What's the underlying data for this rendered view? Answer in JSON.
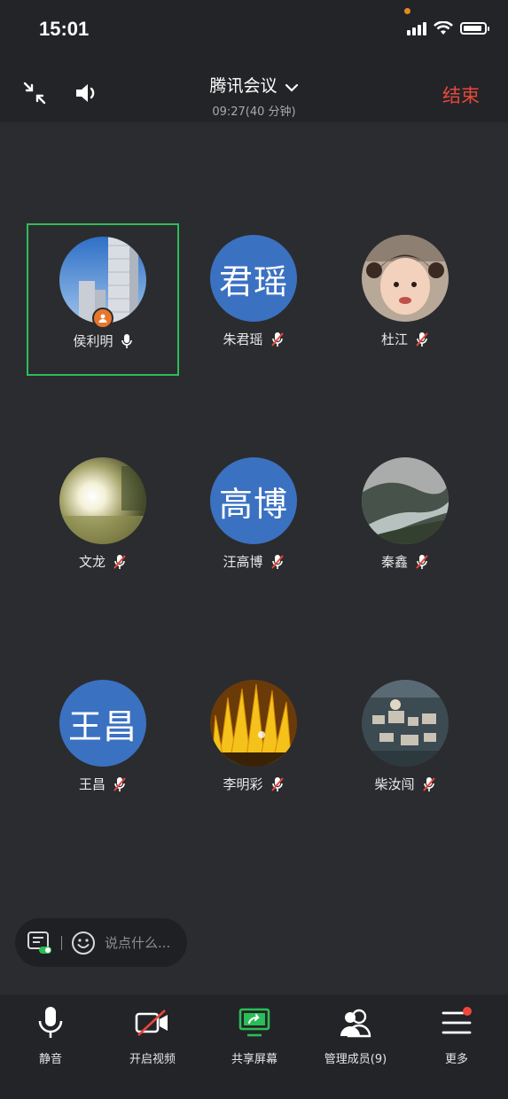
{
  "status_bar": {
    "time": "15:01"
  },
  "header": {
    "title": "腾讯会议",
    "subtitle": "09:27(40 分钟)",
    "end_label": "结束"
  },
  "participants": [
    {
      "name": "侯利明",
      "avatar_text": "",
      "avatar_kind": "photo-buildings",
      "muted": false,
      "host": true,
      "active": true
    },
    {
      "name": "朱君瑶",
      "avatar_text": "君瑶",
      "avatar_kind": "text",
      "muted": true
    },
    {
      "name": "杜江",
      "avatar_text": "",
      "avatar_kind": "photo-child",
      "muted": true
    },
    {
      "name": "文龙",
      "avatar_text": "",
      "avatar_kind": "photo-sunlight",
      "muted": true
    },
    {
      "name": "汪高博",
      "avatar_text": "高博",
      "avatar_kind": "text",
      "muted": true
    },
    {
      "name": "秦鑫",
      "avatar_text": "",
      "avatar_kind": "photo-river",
      "muted": true
    },
    {
      "name": "王昌",
      "avatar_text": "王昌",
      "avatar_kind": "text",
      "muted": true
    },
    {
      "name": "李明彩",
      "avatar_text": "",
      "avatar_kind": "photo-flower",
      "muted": true
    },
    {
      "name": "柴汝闯",
      "avatar_text": "",
      "avatar_kind": "photo-city",
      "muted": true
    }
  ],
  "chat": {
    "placeholder": "说点什么..."
  },
  "toolbar": {
    "mute_label": "静音",
    "video_label": "开启视频",
    "share_label": "共享屏幕",
    "members_label": "管理成员(9)",
    "more_label": "更多"
  },
  "colors": {
    "background": "#2b2c2f",
    "bar": "#232427",
    "end_red": "#e8473c",
    "active_green": "#2bbd58",
    "avatar_blue": "#3b71c1",
    "host_orange": "#e8762b"
  }
}
